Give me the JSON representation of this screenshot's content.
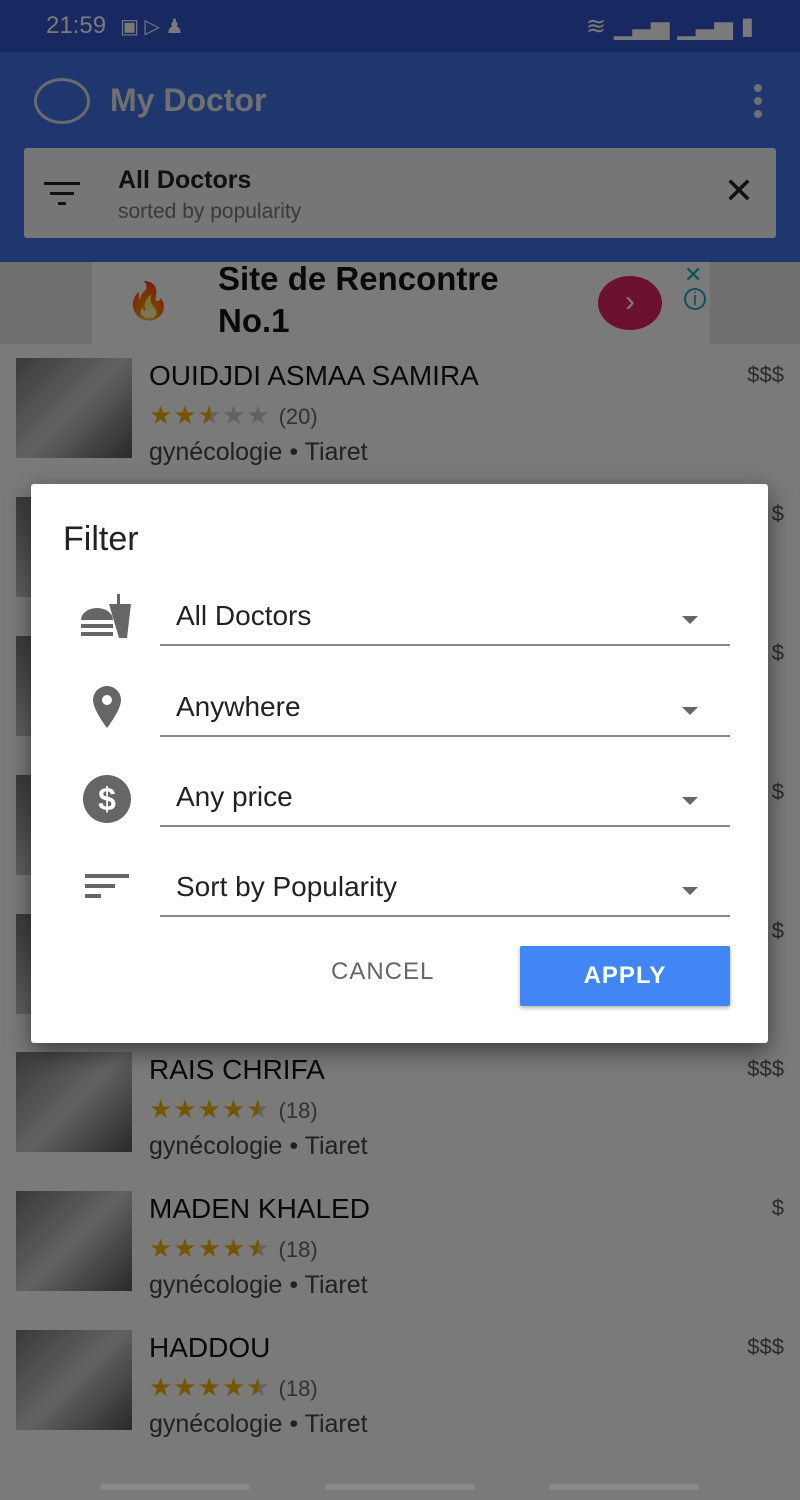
{
  "status_bar": {
    "time": "21:59",
    "icons": [
      "image-icon",
      "play-store-icon",
      "keyhole-icon"
    ],
    "right_icons": [
      "wifi-icon",
      "signal-icon",
      "signal-icon",
      "battery-charging-icon"
    ]
  },
  "app_bar": {
    "title": "My Doctor",
    "filter_title": "All Doctors",
    "filter_subtitle": "sorted by popularity"
  },
  "ad": {
    "text": "Site de Rencontre No.1",
    "accent": "#e0245e"
  },
  "doctors": [
    {
      "name": "OUIDJDI ASMAA SAMIRA",
      "rating": 2.5,
      "count": "(20)",
      "specialty_city": "gynécologie • Tiaret",
      "price": "$$$"
    },
    {
      "name": "",
      "rating": null,
      "count": "",
      "specialty_city": "",
      "price": "$"
    },
    {
      "name": "",
      "rating": null,
      "count": "",
      "specialty_city": "",
      "price": "$"
    },
    {
      "name": "",
      "rating": null,
      "count": "",
      "specialty_city": "",
      "price": "$"
    },
    {
      "name": "",
      "rating": null,
      "count": "",
      "specialty_city": "",
      "price": "$"
    },
    {
      "name": "RAIS CHRIFA",
      "rating": 4.5,
      "count": "(18)",
      "specialty_city": "gynécologie • Tiaret",
      "price": "$$$"
    },
    {
      "name": "MADEN KHALED",
      "rating": 4.5,
      "count": "(18)",
      "specialty_city": "gynécologie • Tiaret",
      "price": "$"
    },
    {
      "name": "HADDOU",
      "rating": 4.5,
      "count": "(18)",
      "specialty_city": "gynécologie • Tiaret",
      "price": "$$$"
    }
  ],
  "dialog": {
    "title": "Filter",
    "fields": [
      {
        "icon": "restaurant-icon",
        "value": "All Doctors"
      },
      {
        "icon": "location-pin-icon",
        "value": "Anywhere"
      },
      {
        "icon": "dollar-icon",
        "value": "Any price"
      },
      {
        "icon": "sort-icon",
        "value": "Sort by Popularity"
      }
    ],
    "cancel": "CANCEL",
    "apply": "APPLY",
    "apply_color": "#4285f4"
  }
}
